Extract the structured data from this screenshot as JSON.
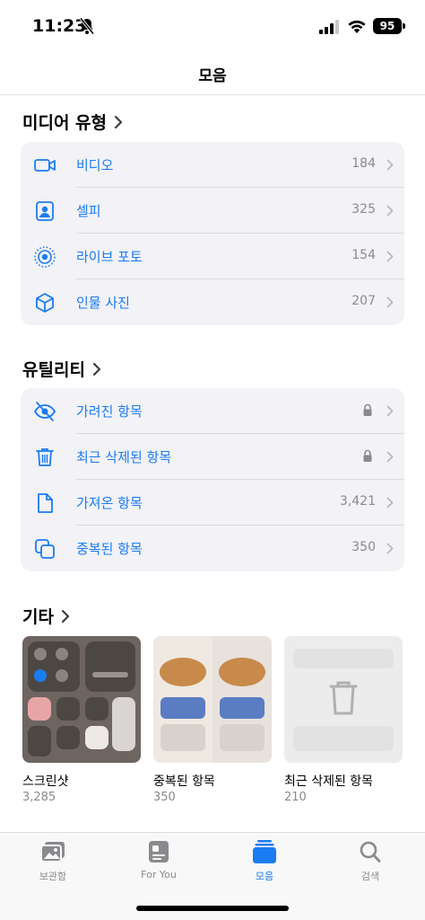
{
  "status": {
    "time": "11:23",
    "battery": "95"
  },
  "nav": {
    "title": "모음"
  },
  "media_types": {
    "header": "미디어 유형",
    "items": [
      {
        "label": "비디오",
        "count": "184",
        "icon": "video-icon"
      },
      {
        "label": "셀피",
        "count": "325",
        "icon": "selfie-icon"
      },
      {
        "label": "라이브 포토",
        "count": "154",
        "icon": "live-photo-icon"
      },
      {
        "label": "인물 사진",
        "count": "207",
        "icon": "cube-icon"
      }
    ]
  },
  "utilities": {
    "header": "유틸리티",
    "items": [
      {
        "label": "가려진 항목",
        "count": "",
        "locked": true,
        "icon": "hidden-eye-icon"
      },
      {
        "label": "최근 삭제된 항목",
        "count": "",
        "locked": true,
        "icon": "trash-icon"
      },
      {
        "label": "가져온 항목",
        "count": "3,421",
        "icon": "import-document-icon"
      },
      {
        "label": "중복된 항목",
        "count": "350",
        "icon": "duplicate-icon"
      }
    ]
  },
  "other": {
    "header": "기타",
    "albums": [
      {
        "label": "스크린샷",
        "count": "3,285"
      },
      {
        "label": "중복된 항목",
        "count": "350"
      },
      {
        "label": "최근 삭제된 항목",
        "count": "210"
      }
    ]
  },
  "tabs": [
    {
      "label": "보관함",
      "icon": "library-icon",
      "active": false
    },
    {
      "label": "For You",
      "icon": "for-you-icon",
      "active": false
    },
    {
      "label": "모음",
      "icon": "collections-icon",
      "active": true
    },
    {
      "label": "검색",
      "icon": "search-icon",
      "active": false
    }
  ],
  "colors": {
    "accent": "#1a7cf2",
    "secondary": "#8a8a8e",
    "group_bg": "#f2f2f7"
  }
}
